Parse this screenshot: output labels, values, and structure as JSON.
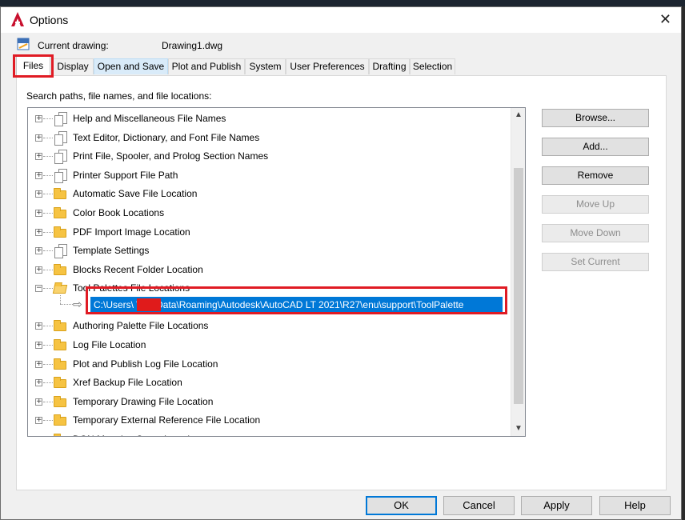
{
  "window": {
    "title": "Options"
  },
  "current_drawing": {
    "label": "Current drawing:",
    "value": "Drawing1.dwg"
  },
  "tabs": [
    {
      "label": "Files",
      "active": true
    },
    {
      "label": "Display"
    },
    {
      "label": "Open and Save"
    },
    {
      "label": "Plot and Publish"
    },
    {
      "label": "System"
    },
    {
      "label": "User Preferences"
    },
    {
      "label": "Drafting"
    },
    {
      "label": "Selection"
    }
  ],
  "files_panel": {
    "section_label": "Search paths, file names, and file locations:",
    "tree_items": [
      {
        "label": "Help and Miscellaneous File Names",
        "icon": "document-stack-icon",
        "expander": "+"
      },
      {
        "label": "Text Editor, Dictionary, and Font File Names",
        "icon": "document-stack-icon",
        "expander": "+"
      },
      {
        "label": "Print File, Spooler, and Prolog Section Names",
        "icon": "document-stack-icon",
        "expander": "+"
      },
      {
        "label": "Printer Support File Path",
        "icon": "document-stack-icon",
        "expander": "+"
      },
      {
        "label": "Automatic Save File Location",
        "icon": "folder-icon",
        "expander": "+"
      },
      {
        "label": "Color Book Locations",
        "icon": "folder-icon",
        "expander": "+"
      },
      {
        "label": "PDF Import Image Location",
        "icon": "folder-icon",
        "expander": "+"
      },
      {
        "label": "Template Settings",
        "icon": "document-stack-icon",
        "expander": "+"
      },
      {
        "label": "Blocks Recent Folder Location",
        "icon": "folder-icon",
        "expander": "+"
      },
      {
        "label": "Tool Palettes File Locations",
        "icon": "folder-open-icon",
        "expander": "−"
      },
      {
        "label": "Authoring Palette File Locations",
        "icon": "folder-icon",
        "expander": "+"
      },
      {
        "label": "Log File Location",
        "icon": "folder-icon",
        "expander": "+"
      },
      {
        "label": "Plot and Publish Log File Location",
        "icon": "folder-icon",
        "expander": "+"
      },
      {
        "label": "Xref Backup File Location",
        "icon": "folder-icon",
        "expander": "+"
      },
      {
        "label": "Temporary Drawing File Location",
        "icon": "folder-icon",
        "expander": "+"
      },
      {
        "label": "Temporary External Reference File Location",
        "icon": "folder-icon",
        "expander": "+"
      },
      {
        "label": "DGN Mapping Setup Location",
        "icon": "folder-icon",
        "expander": "+"
      }
    ],
    "selected_path": "C:\\Users\\          \\AppData\\Roaming\\Autodesk\\AutoCAD LT 2021\\R27\\enu\\support\\ToolPalette"
  },
  "side_buttons": {
    "browse": "Browse...",
    "add": "Add...",
    "remove": "Remove",
    "move_up": "Move Up",
    "move_down": "Move Down",
    "set_current": "Set Current"
  },
  "footer_buttons": {
    "ok": "OK",
    "cancel": "Cancel",
    "apply": "Apply",
    "help": "Help"
  },
  "colors": {
    "selection": "#0078d7",
    "highlight_box": "#e01b24",
    "brand": "#c8102e"
  }
}
